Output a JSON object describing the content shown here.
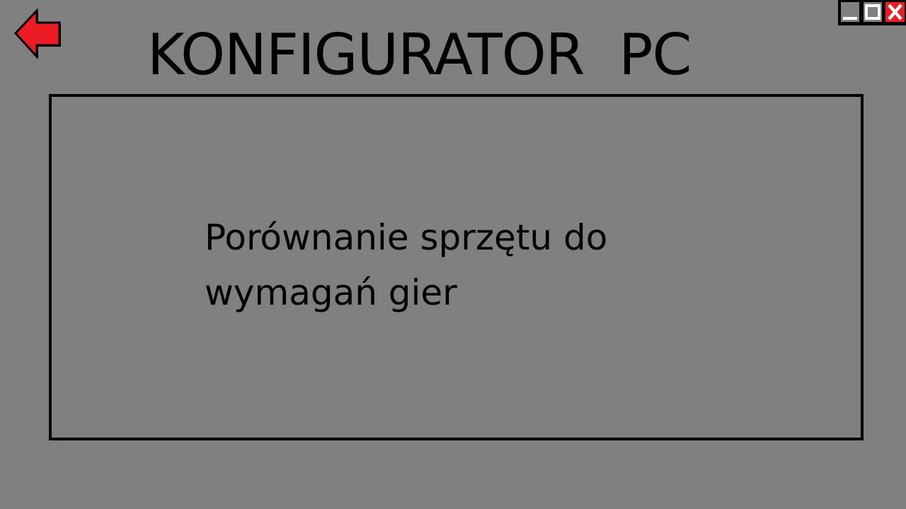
{
  "header": {
    "title": "KONFIGURATOR  PC",
    "back_icon": "arrow-left-icon",
    "back_icon_color": "#ed1c24"
  },
  "window_controls": {
    "minimize_icon": "minimize-icon",
    "maximize_icon": "maximize-icon",
    "close_icon": "close-icon",
    "close_color": "#ed1c24"
  },
  "main": {
    "option_label": "Porównanie sprzętu do wymagań gier"
  },
  "colors": {
    "background": "#808080",
    "border": "#000000",
    "accent": "#ed1c24"
  }
}
